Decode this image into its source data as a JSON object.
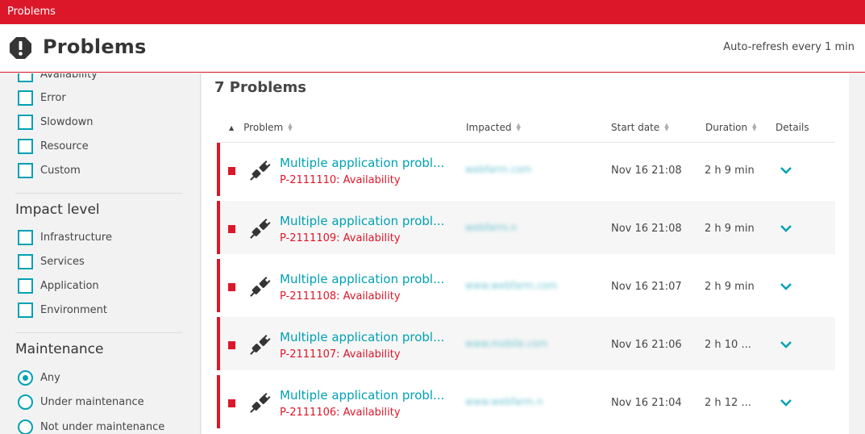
{
  "topbar": {
    "title": "Problems"
  },
  "header": {
    "title": "Problems",
    "icon": "alert-icon",
    "refresh_text": "Auto-refresh every 1 min"
  },
  "sidebar": {
    "type_filters": [
      "Availability",
      "Error",
      "Slowdown",
      "Resource",
      "Custom"
    ],
    "impact_title": "Impact level",
    "impact_filters": [
      "Infrastructure",
      "Services",
      "Application",
      "Environment"
    ],
    "maintenance_title": "Maintenance",
    "maintenance_options": [
      {
        "label": "Any",
        "checked": true
      },
      {
        "label": "Under maintenance",
        "checked": false
      },
      {
        "label": "Not under maintenance",
        "checked": false
      }
    ]
  },
  "main": {
    "count_title": "7 Problems",
    "columns": {
      "problem": "Problem",
      "impacted": "Impacted",
      "start_date": "Start date",
      "duration": "Duration",
      "details": "Details"
    },
    "rows": [
      {
        "title": "Multiple application probl...",
        "id": "P-2111110: Availability",
        "impacted": "webfarm.com",
        "start": "Nov 16 21:08",
        "duration": "2 h 9 min"
      },
      {
        "title": "Multiple application probl...",
        "id": "P-2111109: Availability",
        "impacted": "webfarm.n",
        "start": "Nov 16 21:08",
        "duration": "2 h 9 min"
      },
      {
        "title": "Multiple application probl...",
        "id": "P-2111108: Availability",
        "impacted": "www.webfarm.com",
        "start": "Nov 16 21:07",
        "duration": "2 h 9 min"
      },
      {
        "title": "Multiple application probl...",
        "id": "P-2111107: Availability",
        "impacted": "www.mobile.com",
        "start": "Nov 16 21:06",
        "duration": "2 h 10 ..."
      },
      {
        "title": "Multiple application probl...",
        "id": "P-2111106: Availability",
        "impacted": "www.webfarm.n",
        "start": "Nov 16 21:04",
        "duration": "2 h 12 ..."
      }
    ]
  },
  "colors": {
    "brand_red": "#dc172a",
    "accent_teal": "#00a1b2"
  }
}
